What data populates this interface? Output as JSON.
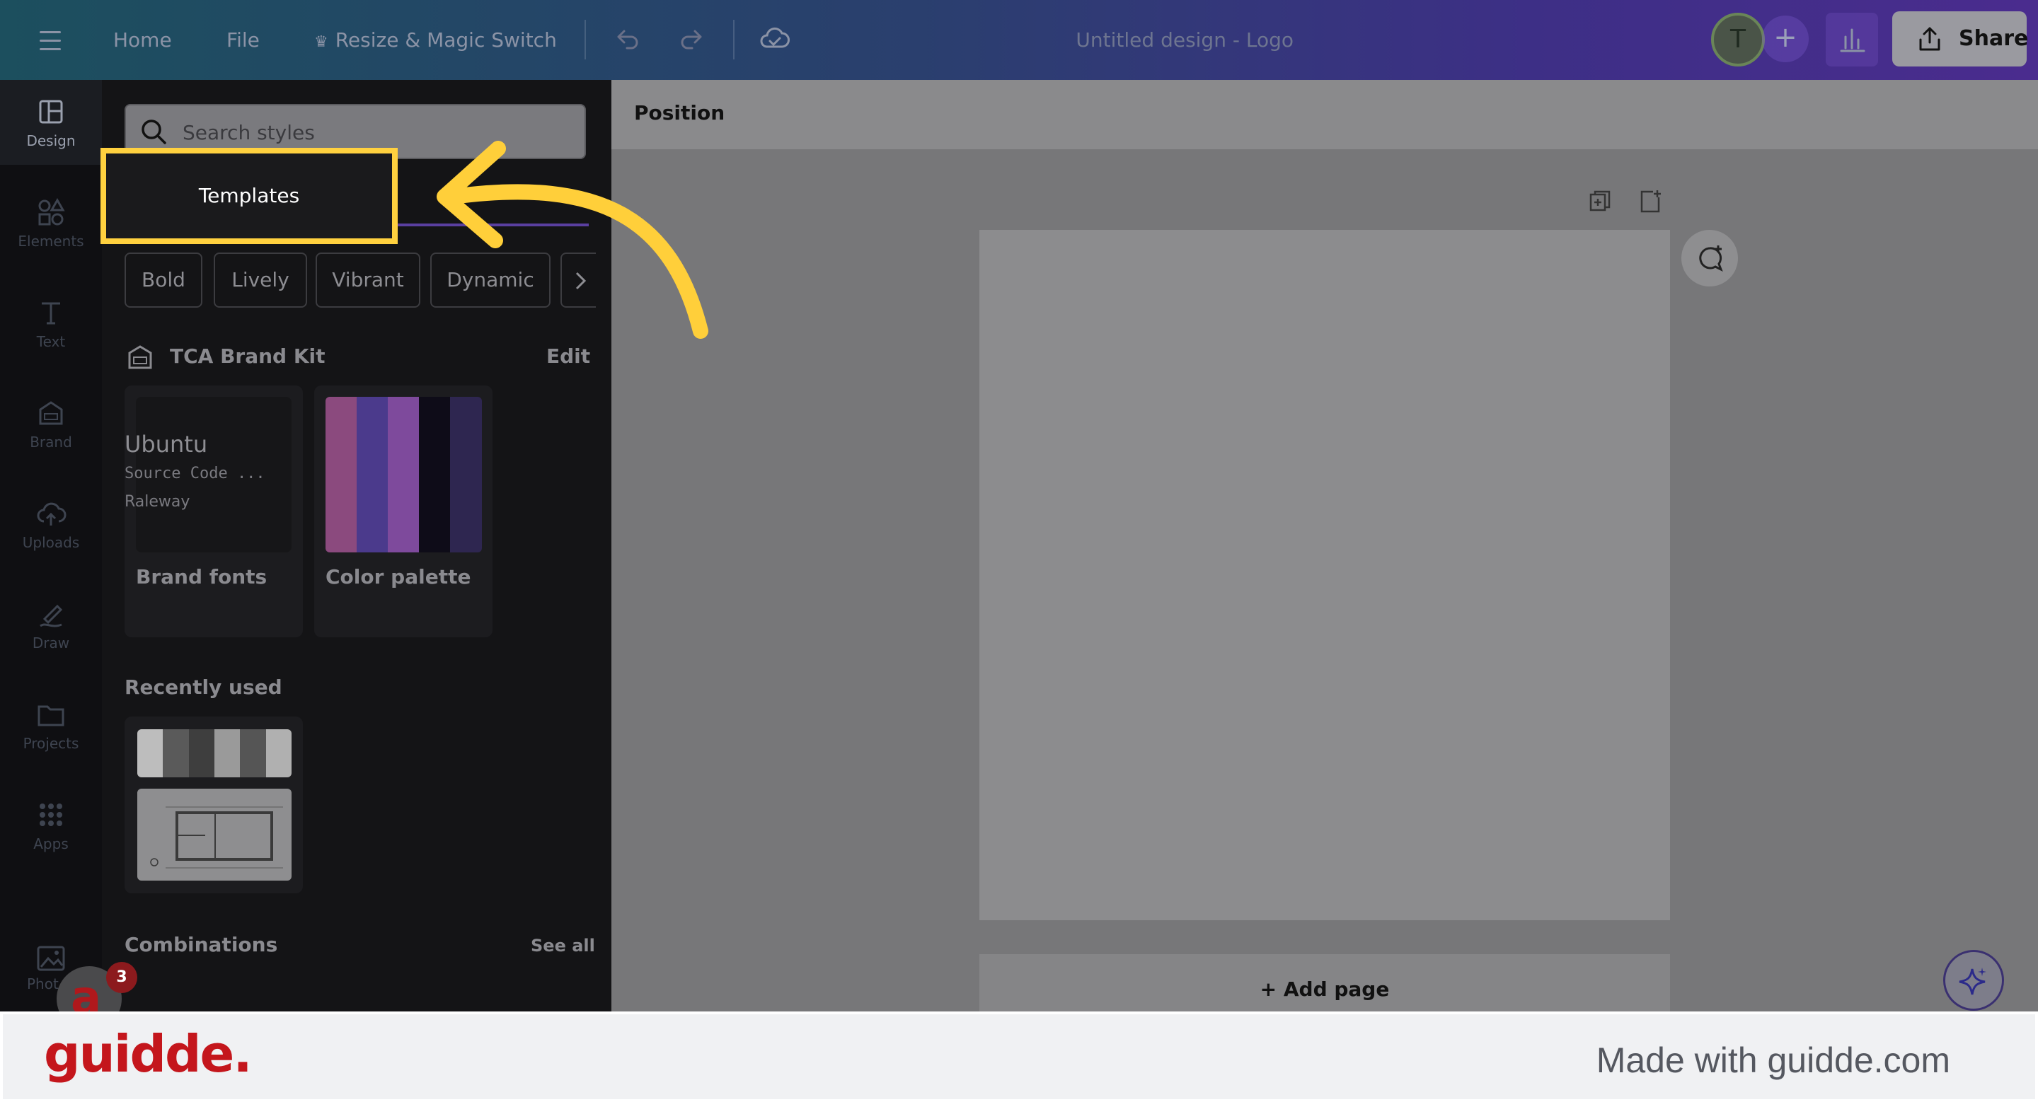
{
  "topbar": {
    "home": "Home",
    "file": "File",
    "resize": "Resize & Magic Switch",
    "design_title": "Untitled design - Logo",
    "avatar_initial": "T",
    "add": "+",
    "share": "Share"
  },
  "rail": {
    "items": [
      {
        "label": "Design",
        "icon": "design-icon"
      },
      {
        "label": "Elements",
        "icon": "elements-icon"
      },
      {
        "label": "Text",
        "icon": "text-icon"
      },
      {
        "label": "Brand",
        "icon": "brand-icon"
      },
      {
        "label": "Uploads",
        "icon": "upload-cloud-icon"
      },
      {
        "label": "Draw",
        "icon": "draw-icon"
      },
      {
        "label": "Projects",
        "icon": "folder-icon"
      },
      {
        "label": "Apps",
        "icon": "apps-grid-icon"
      }
    ],
    "photos_partial": "Phot"
  },
  "panel": {
    "search_placeholder": "Search styles",
    "tab": "Templates",
    "chips": [
      "Bold",
      "Lively",
      "Vibrant",
      "Dynamic"
    ],
    "brand_kit": {
      "title": "TCA Brand Kit",
      "edit": "Edit",
      "fonts": [
        "Ubuntu",
        "Source Code ...",
        "Raleway"
      ],
      "fonts_label": "Brand fonts",
      "palette_label": "Color palette",
      "palette": [
        "#8b4a7e",
        "#4b3a8c",
        "#7e4a9c",
        "#0e0c18",
        "#2e2650"
      ]
    },
    "recently_used": {
      "title": "Recently used",
      "strip": [
        "#bdbdbd",
        "#5a5a5a",
        "#3e3e3e",
        "#9a9a9a",
        "#555555",
        "#b0b0b0"
      ]
    },
    "combinations": {
      "title": "Combinations",
      "see_all": "See all",
      "sets": [
        [
          "#2f3a60",
          "#c85a2c",
          "#e0926e",
          "#a0b8c8",
          "#d8dce0"
        ],
        [
          "#5a3428",
          "#8a4a2c",
          "#c08a3a",
          "#e0c896",
          "#f0e6d0"
        ],
        [
          "#0a0a4a",
          "#1a1aa0",
          "#0a0a30"
        ]
      ]
    }
  },
  "canvas": {
    "position_label": "Position",
    "add_page": "+ Add page"
  },
  "overlay": {
    "badge": "3",
    "logo_letter": "a"
  },
  "footer": {
    "logo": "guidde.",
    "made_with": "Made with guidde.com"
  }
}
